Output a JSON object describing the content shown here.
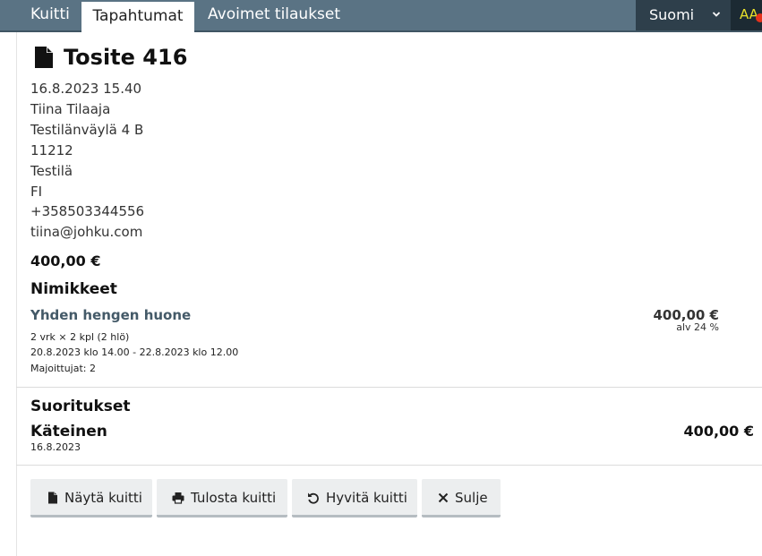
{
  "tabs": [
    {
      "label": "Kuitti"
    },
    {
      "label": "Tapahtumat"
    },
    {
      "label": "Avoimet tilaukset"
    }
  ],
  "language": {
    "selected": "Suomi",
    "icon": "chevron-down-icon"
  },
  "accessibility": {
    "label": "AA"
  },
  "receipt": {
    "title": "Tosite 416",
    "icon": "document-icon",
    "datetime": "16.8.2023 15.40",
    "customer_name": "Tiina Tilaaja",
    "street": "Testilänväylä 4 B",
    "postal_code": "11212",
    "city": "Testilä",
    "country": "FI",
    "phone": "+358503344556",
    "email": "tiina@johku.com",
    "total": "400,00 €"
  },
  "items_section": {
    "heading": "Nimikkeet",
    "items": [
      {
        "name": "Yhden hengen huone",
        "price": "400,00 €",
        "vat": "alv 24 %",
        "quantity": "2 vrk × 2 kpl (2 hlö)",
        "period": "20.8.2023 klo 14.00 - 22.8.2023 klo 12.00",
        "guests": "Majoittujat: 2"
      }
    ]
  },
  "payments_section": {
    "heading": "Suoritukset",
    "payments": [
      {
        "method": "Käteinen",
        "date": "16.8.2023",
        "amount": "400,00 €"
      }
    ]
  },
  "actions": {
    "show_receipt": {
      "label": "Näytä kuitti",
      "icon": "document-icon"
    },
    "print_receipt": {
      "label": "Tulosta kuitti",
      "icon": "printer-icon"
    },
    "refund_receipt": {
      "label": "Hyvitä kuitti",
      "icon": "undo-icon"
    },
    "close": {
      "label": "Sulje",
      "icon": "close-icon"
    }
  }
}
